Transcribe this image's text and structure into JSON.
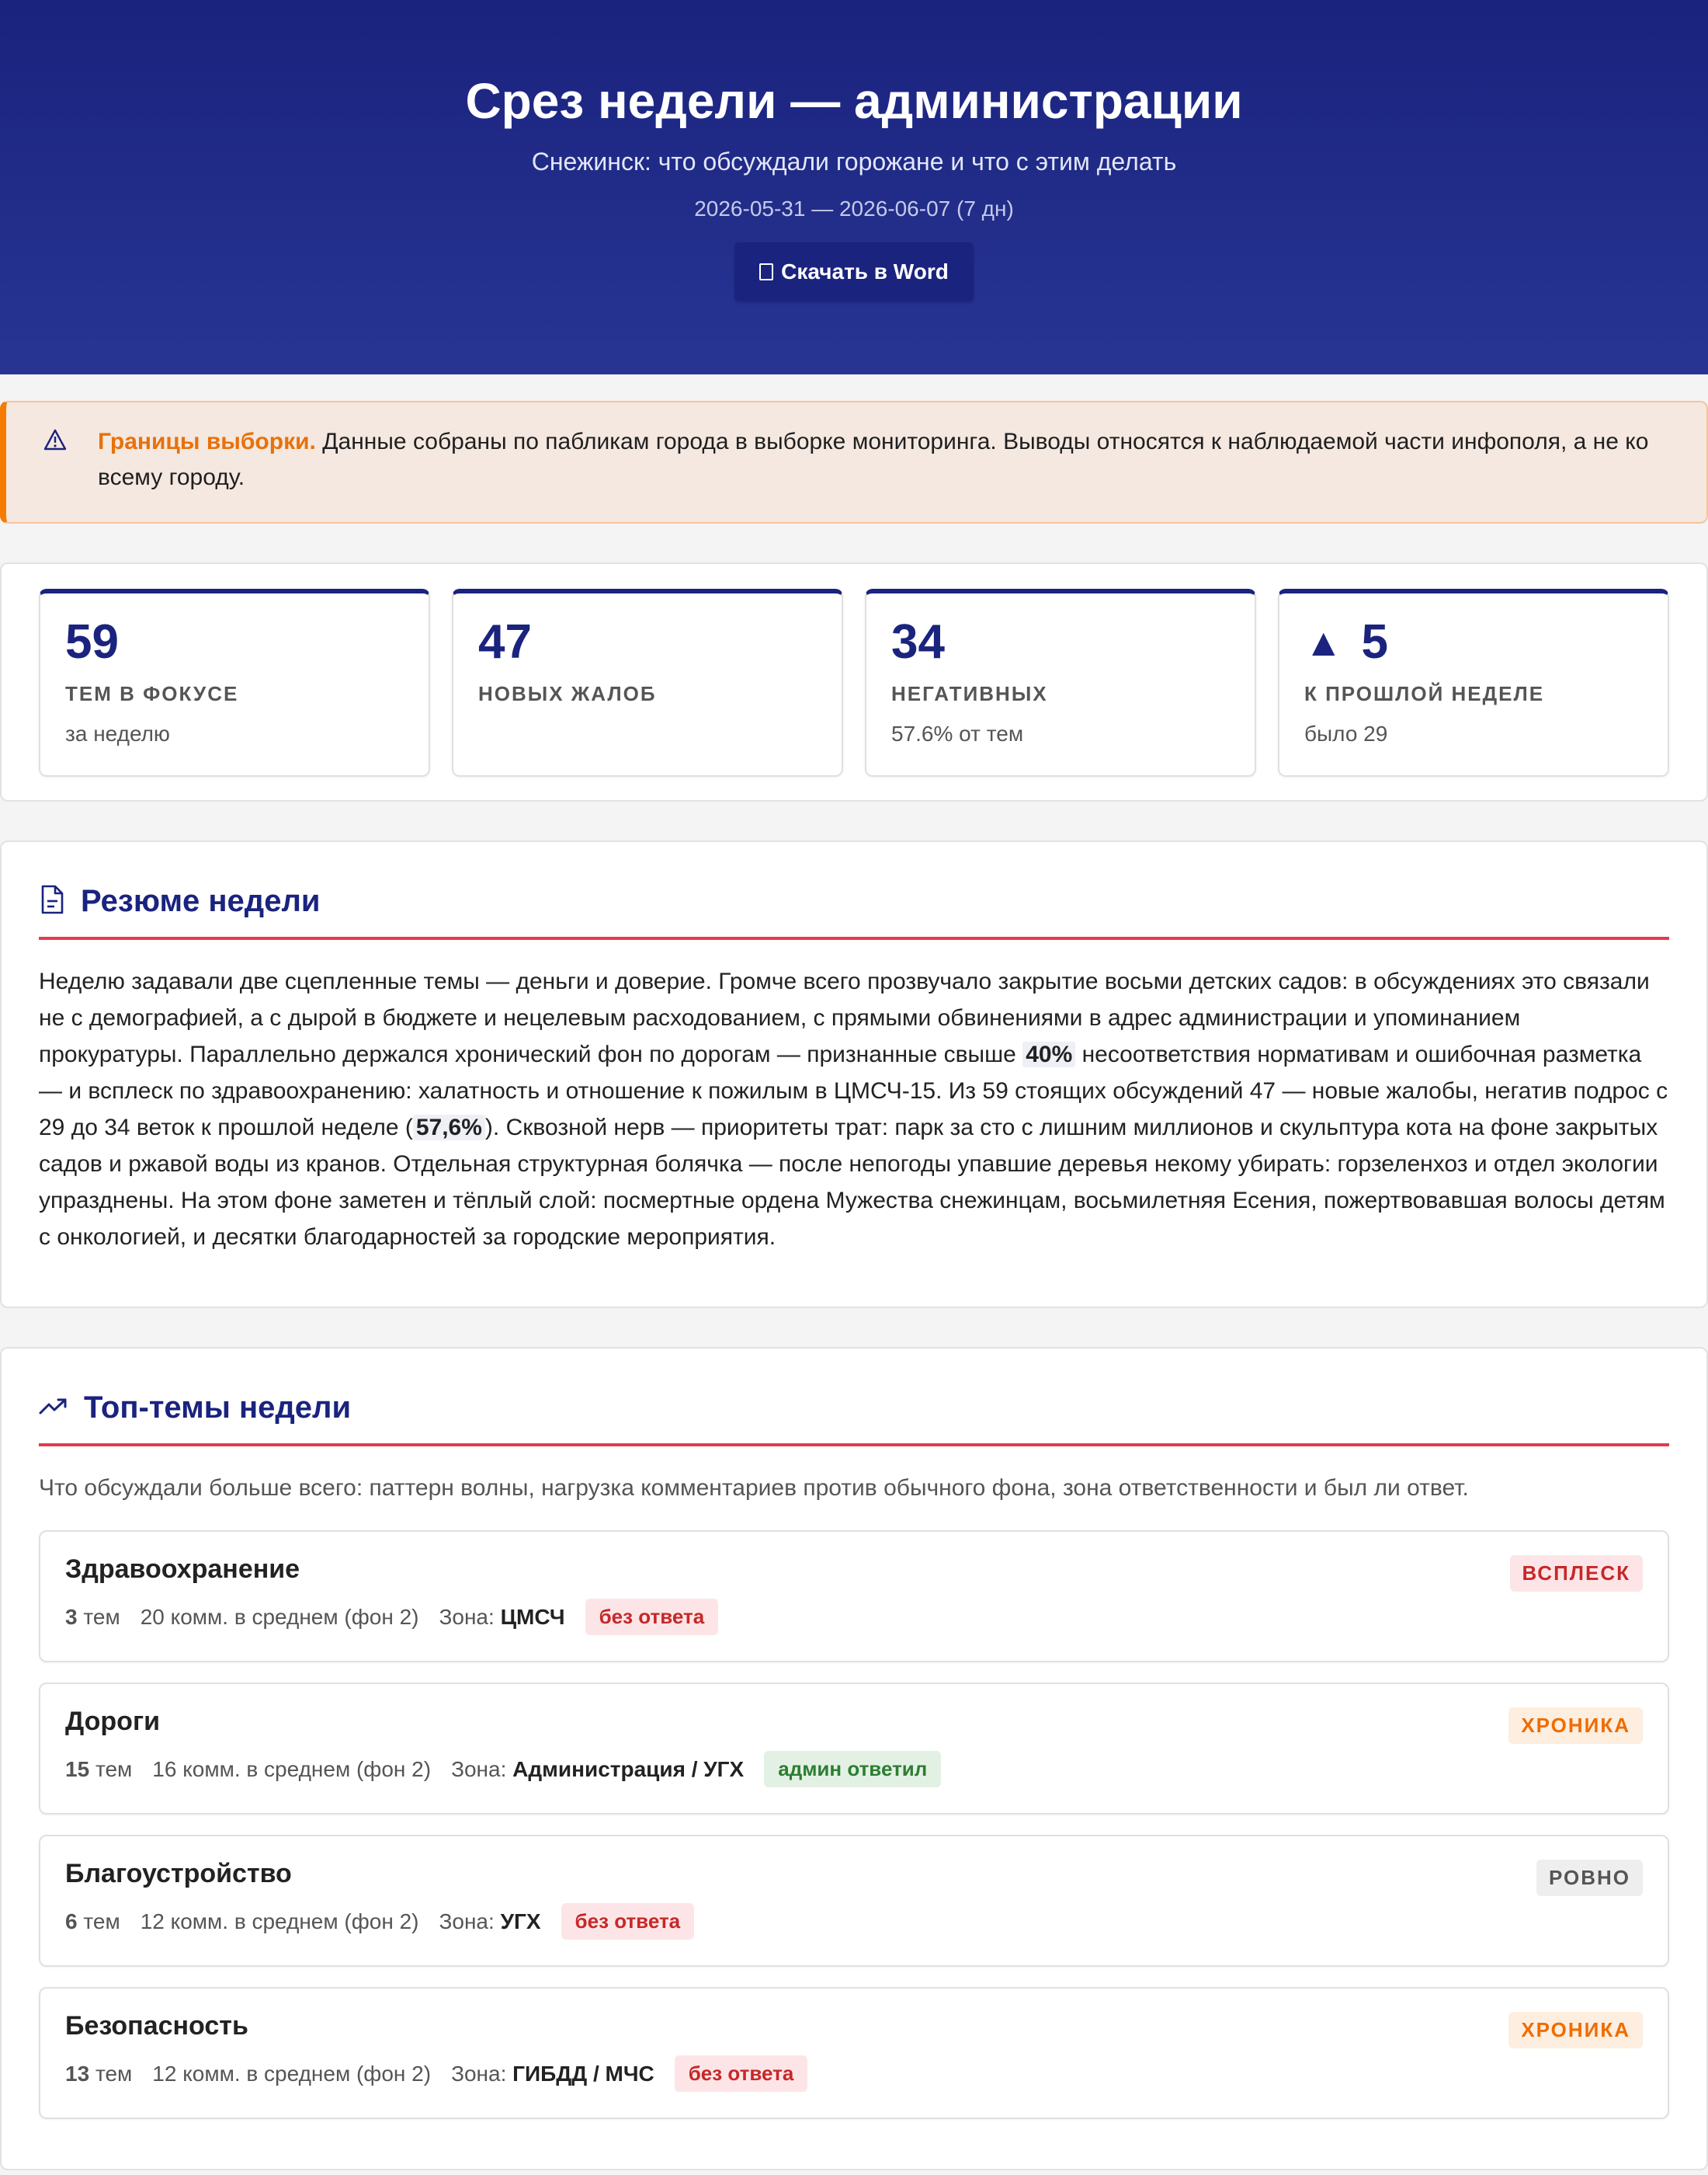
{
  "header": {
    "title": "Срез недели — администрации",
    "subtitle": "Снежинск: что обсуждали горожане и что с этим делать",
    "period": "2026-05-31 — 2026-06-07 (7 дн)",
    "download_label": "Скачать в Word",
    "download_icon": "document-icon"
  },
  "notice": {
    "icon": "warning-icon",
    "lead": "Границы выборки.",
    "text": "Данные собраны по пабликам города в выборке мониторинга. Выводы относятся к наблюдаемой части инфополя, а не ко всему городу."
  },
  "stats": [
    {
      "value": "59",
      "label": "Тем в фокусе",
      "note": "за неделю"
    },
    {
      "value": "47",
      "label": "Новых жалоб",
      "note": ""
    },
    {
      "value": "34",
      "label": "Негативных",
      "note": "57.6% от тем"
    },
    {
      "arrow": "▲",
      "value": "5",
      "label": "К прошлой неделе",
      "note": "было 29"
    }
  ],
  "summary": {
    "title": "Резюме недели",
    "icon": "document-icon",
    "text_1": "Неделю задавали две сцепленные темы — деньги и доверие. Громче всего прозвучало закрытие восьми детских садов: в обсуждениях это связали не с демографией, а с дырой в бюджете и нецелевым расходованием, с прямыми обвинениями в адрес администрации и упоминанием прокуратуры. Параллельно держался хронический фон по дорогам — признанные свыше ",
    "highlight_1": "40%",
    "text_2": " несоответствия нормативам и ошибочная разметка — и всплеск по здравоохранению: халатность и отношение к пожилым в ЦМСЧ-15. Из 59 стоящих обсуждений 47 — новые жалобы, негатив подрос с 29 до 34 веток к прошлой неделе (",
    "highlight_2": "57,6%",
    "text_3": "). Сквозной нерв — приоритеты трат: парк за сто с лишним миллионов и скульптура кота на фоне закрытых садов и ржавой воды из кранов. Отдельная структурная болячка — после непогоды упавшие деревья некому убирать: горзеленхоз и отдел экологии упразднены. На этом фоне заметен и тёплый слой: посмертные ордена Мужества снежинцам, восьмилетняя Есения, пожертвовавшая волосы детям с онкологией, и десятки благодарностей за городские мероприятия."
  },
  "topics": {
    "title": "Топ-темы недели",
    "icon": "trending-up-icon",
    "intro": "Что обсуждали больше всего: паттерн волны, нагрузка комментариев против обычного фона, зона ответственности и был ли ответ.",
    "zone_label": "Зона:",
    "themes_word": "тем",
    "items": [
      {
        "name": "Здравоохранение",
        "count": "3",
        "comments": "20 комм. в среднем (фон 2)",
        "zone": "ЦМСЧ",
        "answer": "без ответа",
        "trend": "ВСПЛЕСК"
      },
      {
        "name": "Дороги",
        "count": "15",
        "comments": "16 комм. в среднем (фон 2)",
        "zone": "Администрация / УГХ",
        "answer": "админ ответил",
        "trend": "ХРОНИКА"
      },
      {
        "name": "Благоустройство",
        "count": "6",
        "comments": "12 комм. в среднем (фон 2)",
        "zone": "УГХ",
        "answer": "без ответа",
        "trend": "РОВНО"
      },
      {
        "name": "Безопасность",
        "count": "13",
        "comments": "12 комм. в среднем (фон 2)",
        "zone": "ГИБДД / МЧС",
        "answer": "без ответа",
        "trend": "ХРОНИКА"
      }
    ]
  },
  "colors": {
    "primary": "#1a237e",
    "accent_line": "#e53950",
    "warning": "#f57c00",
    "no_answer": "#c62828",
    "answered": "#2e7d32"
  }
}
